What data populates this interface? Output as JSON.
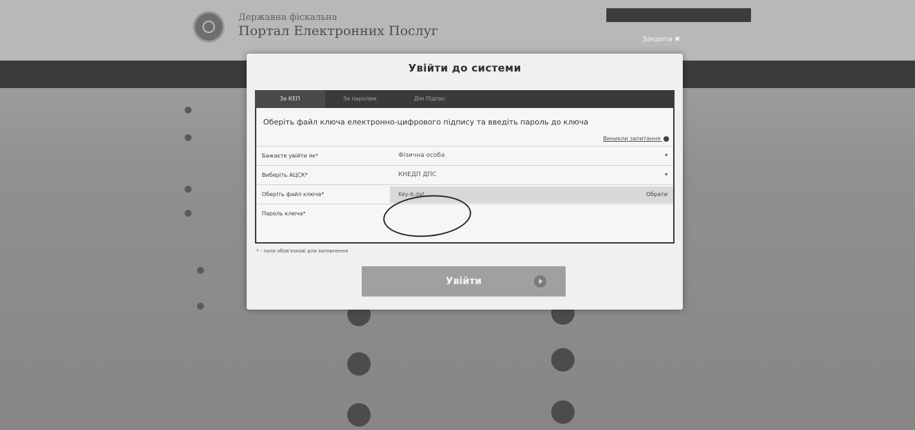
{
  "site": {
    "name_top": "Державна фіскальна",
    "name": "Портал Електронних Послуг",
    "top_btn_1": "",
    "top_btn_2": "",
    "close_link": "Закрити ✖"
  },
  "modal": {
    "title": "Увійти до системи",
    "tabs": [
      {
        "label": "За КЕП",
        "active": true
      },
      {
        "label": "За паролем"
      },
      {
        "label": "Дім Підпис"
      },
      {
        "label": ""
      },
      {
        "label": ""
      },
      {
        "label": ""
      }
    ],
    "heading": "Оберіть файл ключа електронно-цифрового підпису та введіть пароль до ключа",
    "help_link": "Виникли запитання",
    "fields": {
      "enter_as_label": "Бажаєте увійти як*",
      "enter_as_value": "Фізична особа",
      "acsk_label": "Виберіть АЦСК*",
      "acsk_value": "КНЕДП ДПС",
      "file_label": "Оберіть файл ключа*",
      "file_value": "Key-6.dat",
      "browse_label": "Обрати",
      "password_label": "Пароль ключа*"
    },
    "required_note": "* - поля обов'язкові для заповнення",
    "login_button": "Увійти"
  }
}
